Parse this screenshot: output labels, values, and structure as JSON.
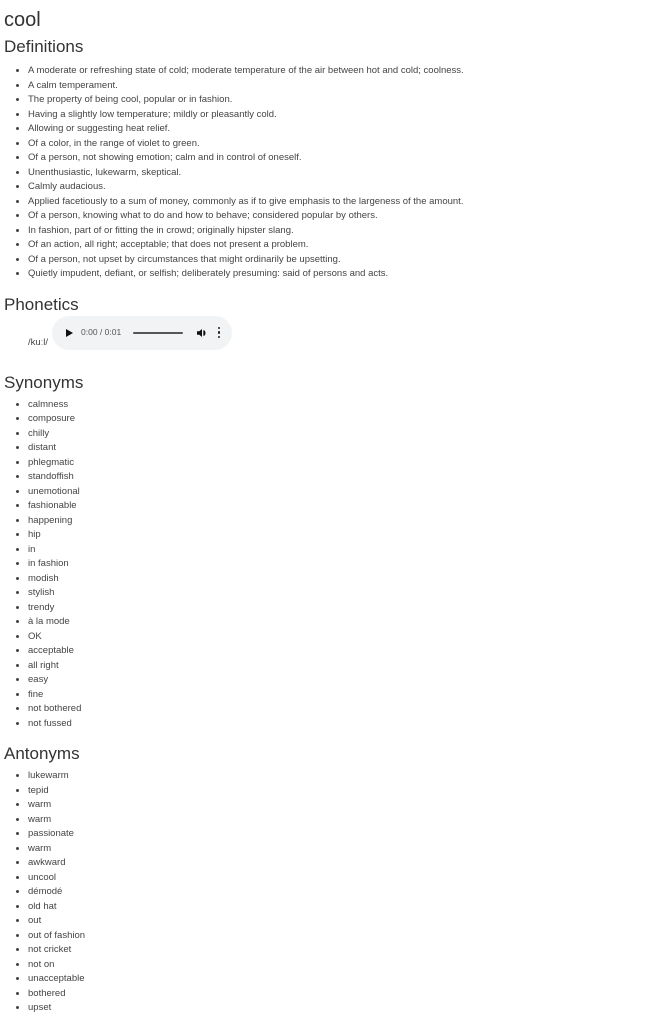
{
  "word": "cool",
  "sections": {
    "definitions": "Definitions",
    "phonetics": "Phonetics",
    "synonyms": "Synonyms",
    "antonyms": "Antonyms"
  },
  "definitions": [
    "A moderate or refreshing state of cold; moderate temperature of the air between hot and cold; coolness.",
    "A calm temperament.",
    "The property of being cool, popular or in fashion.",
    "Having a slightly low temperature; mildly or pleasantly cold.",
    "Allowing or suggesting heat relief.",
    "Of a color, in the range of violet to green.",
    "Of a person, not showing emotion; calm and in control of oneself.",
    "Unenthusiastic, lukewarm, skeptical.",
    "Calmly audacious.",
    "Applied facetiously to a sum of money, commonly as if to give emphasis to the largeness of the amount.",
    "Of a person, knowing what to do and how to behave; considered popular by others.",
    "In fashion, part of or fitting the in crowd; originally hipster slang.",
    "Of an action, all right; acceptable; that does not present a problem.",
    "Of a person, not upset by circumstances that might ordinarily be upsetting.",
    "Quietly impudent, defiant, or selfish; deliberately presuming: said of persons and acts."
  ],
  "phonetics": [
    {
      "text": "/kuːl/",
      "audio": {
        "time": "0:00 / 0:01",
        "progress": 0,
        "icons": [
          "play-icon",
          "volume-icon",
          "more-options-icon"
        ]
      }
    }
  ],
  "synonyms": [
    "calmness",
    "composure",
    "chilly",
    "distant",
    "phlegmatic",
    "standoffish",
    "unemotional",
    "fashionable",
    "happening",
    "hip",
    "in",
    "in fashion",
    "modish",
    "stylish",
    "trendy",
    "à la mode",
    "OK",
    "acceptable",
    "all right",
    "easy",
    "fine",
    "not bothered",
    "not fussed"
  ],
  "antonyms": [
    "lukewarm",
    "tepid",
    "warm",
    "warm",
    "passionate",
    "warm",
    "awkward",
    "uncool",
    "démodé",
    "old hat",
    "out",
    "out of fashion",
    "not cricket",
    "not on",
    "unacceptable",
    "bothered",
    "upset"
  ]
}
